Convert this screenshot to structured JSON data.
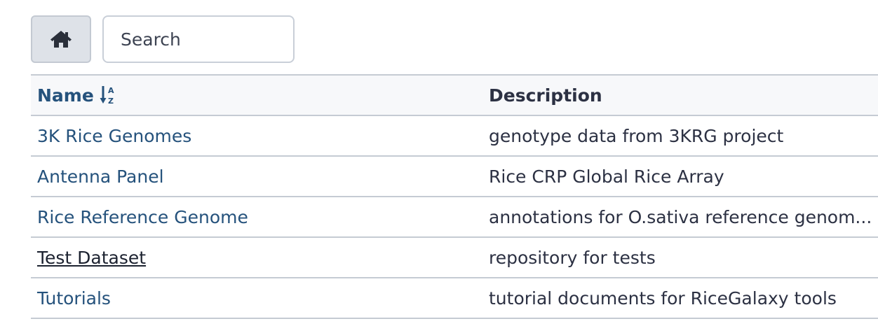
{
  "toolbar": {
    "home_icon": "home-icon",
    "search": {
      "placeholder": "Search",
      "value": ""
    }
  },
  "table": {
    "headers": {
      "name": "Name",
      "name_sort_icon": "sort-alpha-down-icon",
      "description": "Description"
    },
    "rows": [
      {
        "name": "3K Rice Genomes",
        "description": "genotype data from 3KRG project",
        "hovered": false
      },
      {
        "name": "Antenna Panel",
        "description": "Rice CRP Global Rice Array",
        "hovered": false
      },
      {
        "name": "Rice Reference Genome",
        "description": "annotations for O.sativa reference genom...",
        "hovered": false
      },
      {
        "name": "Test Dataset",
        "description": "repository for tests",
        "hovered": true
      },
      {
        "name": "Tutorials",
        "description": "tutorial documents for RiceGalaxy tools",
        "hovered": false
      }
    ]
  },
  "colors": {
    "link": "#25527c",
    "link_hover": "#1c2230",
    "text": "#2c3143",
    "header_bg": "#f7f8fa",
    "border": "#c5cbd3",
    "home_button_bg": "#dee2e8"
  }
}
